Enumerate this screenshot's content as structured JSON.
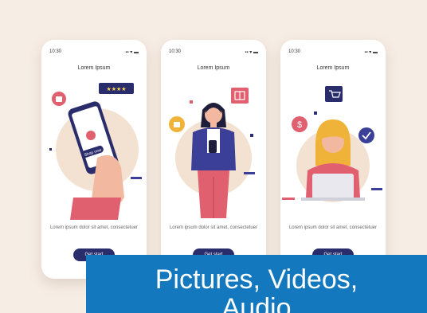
{
  "phones": [
    {
      "time": "10:30",
      "title": "Lorem Ipsum",
      "description": "Lorem ipsum dolor sit amet, consectetuer",
      "button": "Get start",
      "overlay_label": "Shop now"
    },
    {
      "time": "10:30",
      "title": "Lorem Ipsum",
      "description": "Lorem ipsum dolor sit amet, consectetuer",
      "button": "Get start"
    },
    {
      "time": "10:30",
      "title": "Lorem Ipsum",
      "description": "Lorem ipsum dolor sit amet, consectetuer",
      "button": "Get start"
    }
  ],
  "status_icons": "▪▪ ▾ ▬",
  "caption": {
    "line1": "Pictures, Videos,",
    "line2": "Audio"
  },
  "colors": {
    "background": "#f6ede4",
    "navy": "#2a2d6b",
    "pink": "#e0606f",
    "purple": "#3b3f98",
    "caption_bg": "#1478be"
  }
}
